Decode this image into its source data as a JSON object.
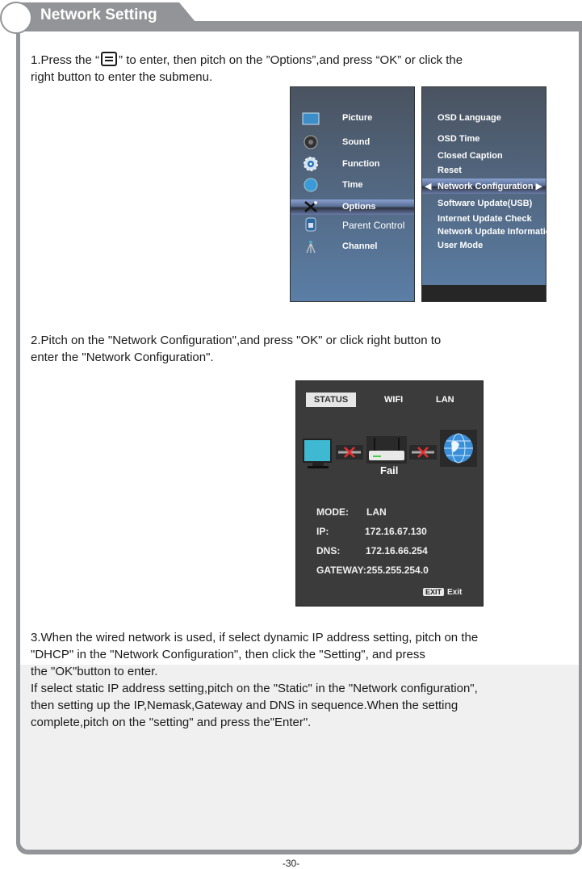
{
  "header": {
    "title": "Network Setting"
  },
  "step1": {
    "text_before": "1.Press the “",
    "icon": "menu-key-icon",
    "text_after": "” to enter, then pitch on the ”Options”,and press “OK” or click the",
    "line2": "right button to enter the submenu."
  },
  "main_menu": {
    "items": [
      {
        "label": "Picture",
        "icon": "picture-icon"
      },
      {
        "label": "Sound",
        "icon": "sound-icon"
      },
      {
        "label": "Function",
        "icon": "function-gear-icon"
      },
      {
        "label": "Time",
        "icon": "clock-icon"
      },
      {
        "label": "Options",
        "icon": "tools-icon",
        "selected": true
      },
      {
        "label": "Parent  Control",
        "icon": "lock-icon"
      },
      {
        "label": "Channel",
        "icon": "antenna-icon"
      }
    ]
  },
  "options_menu": {
    "items": [
      {
        "label": "OSD Language"
      },
      {
        "label": "OSD Time"
      },
      {
        "label": "Closed Caption"
      },
      {
        "label": "Reset"
      },
      {
        "label": "Network Configuration",
        "selected": true
      },
      {
        "label": "Software Update(USB)"
      },
      {
        "label": "Internet Update Check"
      },
      {
        "label": "Network Update Information"
      },
      {
        "label": "User Mode"
      }
    ]
  },
  "step2": {
    "line1": "2.Pitch on the \"Network Configuration\",and press \"OK\" or click right button to",
    "line2": "enter the \"Network Configuration\"."
  },
  "network_screen": {
    "tabs": [
      "STATUS",
      "WIFI",
      "LAN"
    ],
    "connection_status": "Fail",
    "fields": [
      {
        "label": "MODE:",
        "value": "LAN"
      },
      {
        "label": "IP:",
        "value": "172.16.67.130"
      },
      {
        "label": "DNS:",
        "value": "172.16.66.254"
      },
      {
        "label": "GATEWAY:",
        "value": "255.255.254.0"
      }
    ],
    "exit_key": "EXIT",
    "exit_label": "Exit"
  },
  "step3": {
    "lines": [
      "3.When the wired network is used, if select dynamic IP address setting, pitch on the",
      "\"DHCP\" in the \"Network Configuration\", then click the \"Setting\", and press",
      "the \"OK\"button to enter.",
      "If select static IP address setting,pitch on the \"Static\" in the \"Network configuration\",",
      "then setting up the IP,Nemask,Gateway and DNS in sequence.When the setting",
      "complete,pitch on the \"setting\" and press the\"Enter\"."
    ]
  },
  "footer": {
    "page_number": "-30-"
  }
}
